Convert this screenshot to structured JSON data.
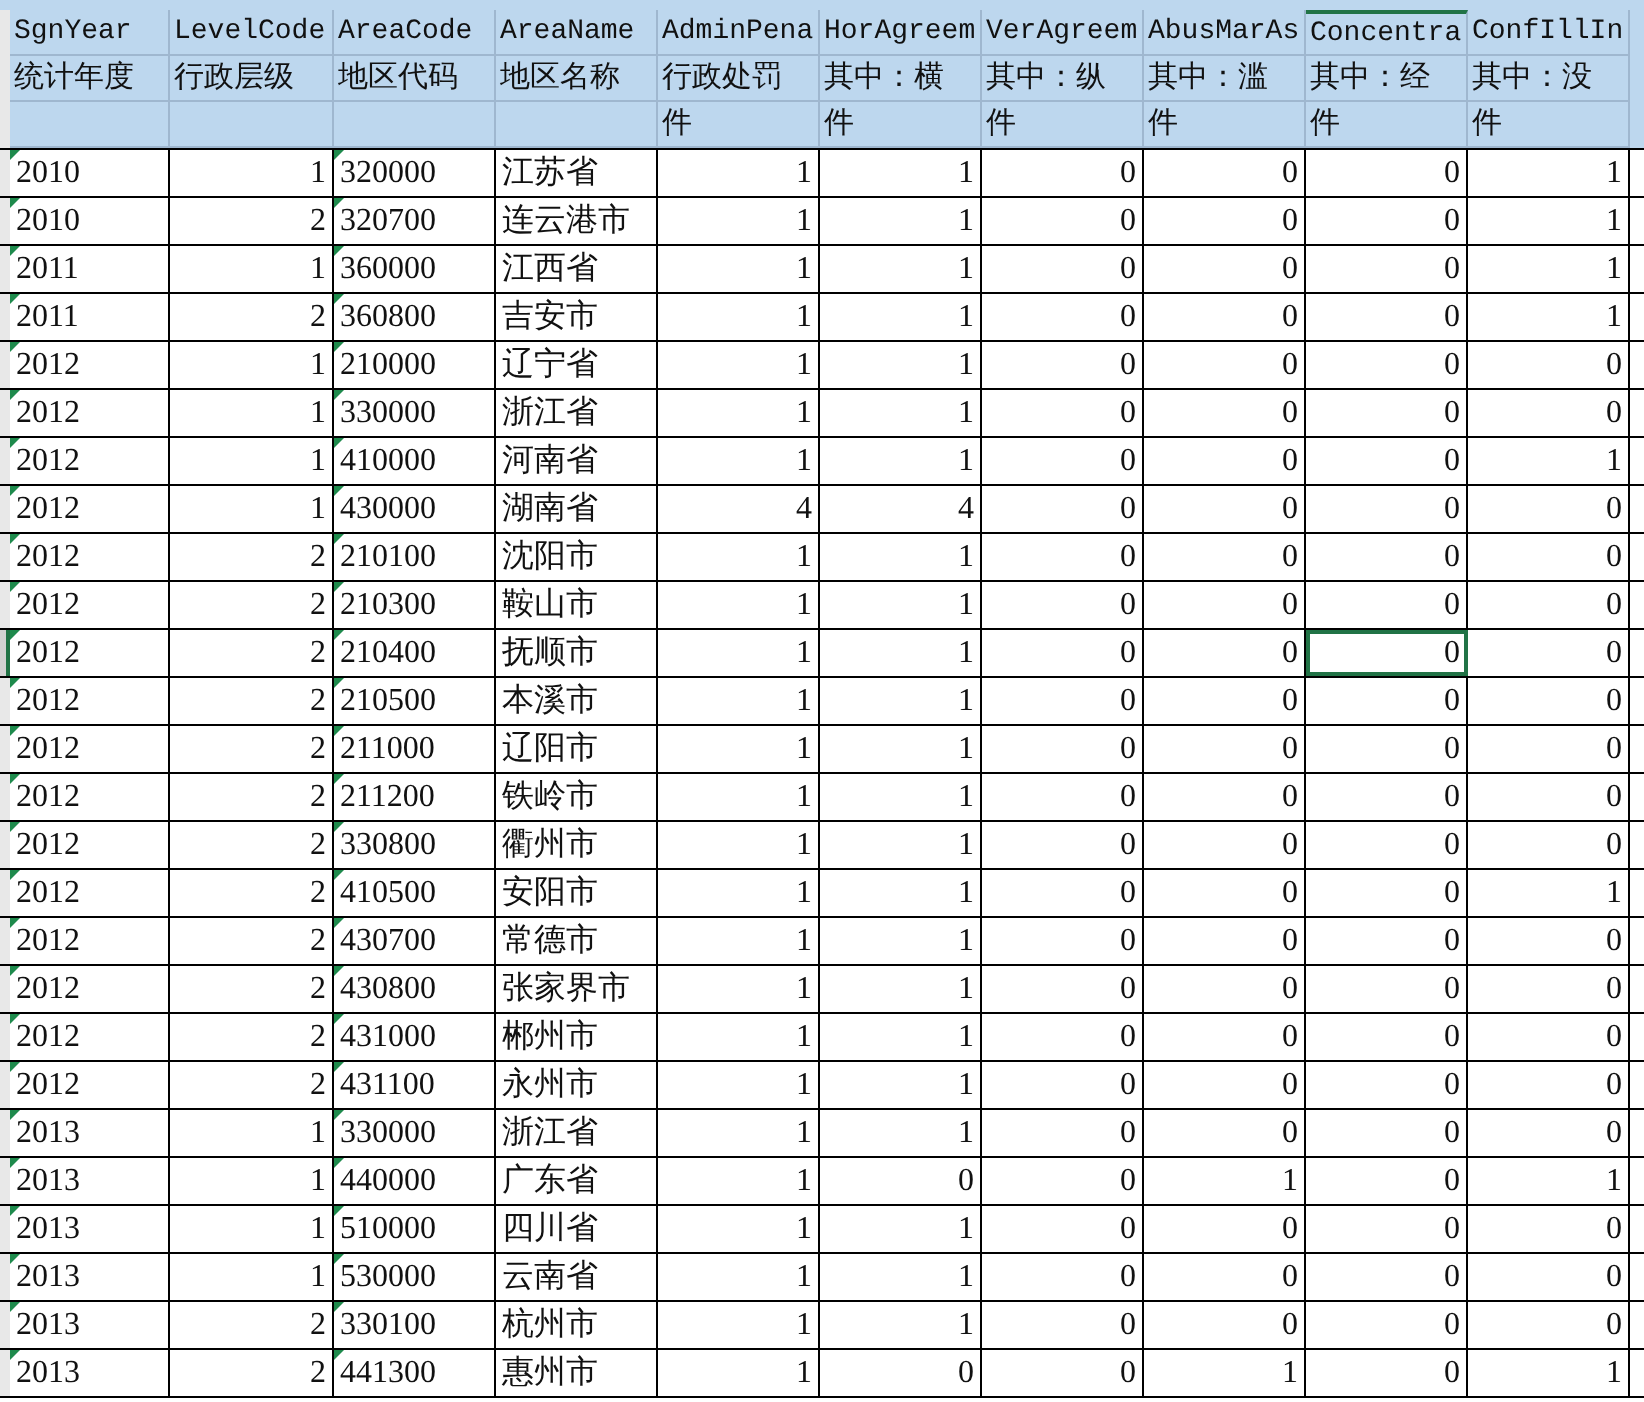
{
  "columns": [
    {
      "name": "SgnYear",
      "label": "统计年度",
      "kind": "text",
      "selected": false
    },
    {
      "name": "LevelCode",
      "label": "行政层级",
      "kind": "number",
      "selected": false
    },
    {
      "name": "AreaCode",
      "label": "地区代码",
      "kind": "text",
      "selected": false
    },
    {
      "name": "AreaName",
      "label": "地区名称",
      "kind": "text",
      "selected": false
    },
    {
      "name": "AdminPena",
      "label": "行政处罚",
      "unit": "件",
      "kind": "number",
      "selected": false
    },
    {
      "name": "HorAgreem",
      "label": "其中：横",
      "unit": "件",
      "kind": "number",
      "selected": false
    },
    {
      "name": "VerAgreem",
      "label": "其中：纵",
      "unit": "件",
      "kind": "number",
      "selected": false
    },
    {
      "name": "AbusMarAs",
      "label": "其中：滥",
      "unit": "件",
      "kind": "number",
      "selected": false
    },
    {
      "name": "Concentra",
      "label": "其中：经",
      "unit": "件",
      "kind": "number",
      "selected": true
    },
    {
      "name": "ConfIllIn",
      "label": "其中：没",
      "unit": "件",
      "kind": "number",
      "selected": false
    }
  ],
  "rows": [
    {
      "cells": [
        "2010",
        "1",
        "320000",
        "江苏省",
        "1",
        "1",
        "0",
        "0",
        "0",
        "1"
      ],
      "selected": false
    },
    {
      "cells": [
        "2010",
        "2",
        "320700",
        "连云港市",
        "1",
        "1",
        "0",
        "0",
        "0",
        "1"
      ],
      "selected": false
    },
    {
      "cells": [
        "2011",
        "1",
        "360000",
        "江西省",
        "1",
        "1",
        "0",
        "0",
        "0",
        "1"
      ],
      "selected": false
    },
    {
      "cells": [
        "2011",
        "2",
        "360800",
        "吉安市",
        "1",
        "1",
        "0",
        "0",
        "0",
        "1"
      ],
      "selected": false
    },
    {
      "cells": [
        "2012",
        "1",
        "210000",
        "辽宁省",
        "1",
        "1",
        "0",
        "0",
        "0",
        "0"
      ],
      "selected": false
    },
    {
      "cells": [
        "2012",
        "1",
        "330000",
        "浙江省",
        "1",
        "1",
        "0",
        "0",
        "0",
        "0"
      ],
      "selected": false
    },
    {
      "cells": [
        "2012",
        "1",
        "410000",
        "河南省",
        "1",
        "1",
        "0",
        "0",
        "0",
        "1"
      ],
      "selected": false
    },
    {
      "cells": [
        "2012",
        "1",
        "430000",
        "湖南省",
        "4",
        "4",
        "0",
        "0",
        "0",
        "0"
      ],
      "selected": false
    },
    {
      "cells": [
        "2012",
        "2",
        "210100",
        "沈阳市",
        "1",
        "1",
        "0",
        "0",
        "0",
        "0"
      ],
      "selected": false
    },
    {
      "cells": [
        "2012",
        "2",
        "210300",
        "鞍山市",
        "1",
        "1",
        "0",
        "0",
        "0",
        "0"
      ],
      "selected": false
    },
    {
      "cells": [
        "2012",
        "2",
        "210400",
        "抚顺市",
        "1",
        "1",
        "0",
        "0",
        "0",
        "0"
      ],
      "selected": true
    },
    {
      "cells": [
        "2012",
        "2",
        "210500",
        "本溪市",
        "1",
        "1",
        "0",
        "0",
        "0",
        "0"
      ],
      "selected": false
    },
    {
      "cells": [
        "2012",
        "2",
        "211000",
        "辽阳市",
        "1",
        "1",
        "0",
        "0",
        "0",
        "0"
      ],
      "selected": false
    },
    {
      "cells": [
        "2012",
        "2",
        "211200",
        "铁岭市",
        "1",
        "1",
        "0",
        "0",
        "0",
        "0"
      ],
      "selected": false
    },
    {
      "cells": [
        "2012",
        "2",
        "330800",
        "衢州市",
        "1",
        "1",
        "0",
        "0",
        "0",
        "0"
      ],
      "selected": false
    },
    {
      "cells": [
        "2012",
        "2",
        "410500",
        "安阳市",
        "1",
        "1",
        "0",
        "0",
        "0",
        "1"
      ],
      "selected": false
    },
    {
      "cells": [
        "2012",
        "2",
        "430700",
        "常德市",
        "1",
        "1",
        "0",
        "0",
        "0",
        "0"
      ],
      "selected": false
    },
    {
      "cells": [
        "2012",
        "2",
        "430800",
        "张家界市",
        "1",
        "1",
        "0",
        "0",
        "0",
        "0"
      ],
      "selected": false
    },
    {
      "cells": [
        "2012",
        "2",
        "431000",
        "郴州市",
        "1",
        "1",
        "0",
        "0",
        "0",
        "0"
      ],
      "selected": false
    },
    {
      "cells": [
        "2012",
        "2",
        "431100",
        "永州市",
        "1",
        "1",
        "0",
        "0",
        "0",
        "0"
      ],
      "selected": false
    },
    {
      "cells": [
        "2013",
        "1",
        "330000",
        "浙江省",
        "1",
        "1",
        "0",
        "0",
        "0",
        "0"
      ],
      "selected": false
    },
    {
      "cells": [
        "2013",
        "1",
        "440000",
        "广东省",
        "1",
        "0",
        "0",
        "1",
        "0",
        "1"
      ],
      "selected": false
    },
    {
      "cells": [
        "2013",
        "1",
        "510000",
        "四川省",
        "1",
        "1",
        "0",
        "0",
        "0",
        "0"
      ],
      "selected": false
    },
    {
      "cells": [
        "2013",
        "1",
        "530000",
        "云南省",
        "1",
        "1",
        "0",
        "0",
        "0",
        "0"
      ],
      "selected": false
    },
    {
      "cells": [
        "2013",
        "2",
        "330100",
        "杭州市",
        "1",
        "1",
        "0",
        "0",
        "0",
        "0"
      ],
      "selected": false
    },
    {
      "cells": [
        "2013",
        "2",
        "441300",
        "惠州市",
        "1",
        "0",
        "0",
        "1",
        "0",
        "1"
      ],
      "selected": false
    }
  ]
}
